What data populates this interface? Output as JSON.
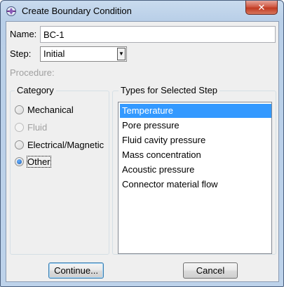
{
  "window": {
    "title": "Create Boundary Condition",
    "close_glyph": "✕",
    "title_icon": "abaqus-icon"
  },
  "form": {
    "name_label": "Name:",
    "name_value": "BC-1",
    "step_label": "Step:",
    "step_value": "Initial",
    "procedure_label": "Procedure:"
  },
  "category": {
    "title": "Category",
    "options": [
      {
        "label": "Mechanical",
        "checked": false,
        "disabled": false
      },
      {
        "label": "Fluid",
        "checked": false,
        "disabled": true
      },
      {
        "label": "Electrical/Magnetic",
        "checked": false,
        "disabled": false
      },
      {
        "label": "Other",
        "checked": true,
        "disabled": false
      }
    ]
  },
  "types": {
    "title": "Types for Selected Step",
    "items": [
      {
        "label": "Temperature",
        "selected": true
      },
      {
        "label": "Pore pressure",
        "selected": false
      },
      {
        "label": "Fluid cavity pressure",
        "selected": false
      },
      {
        "label": "Mass concentration",
        "selected": false
      },
      {
        "label": "Acoustic pressure",
        "selected": false
      },
      {
        "label": "Connector material flow",
        "selected": false
      }
    ]
  },
  "buttons": {
    "continue_label": "Continue...",
    "cancel_label": "Cancel"
  },
  "colors": {
    "selection": "#3399ff",
    "title_gradient_top": "#c9dbee",
    "close_red": "#c03b22"
  }
}
